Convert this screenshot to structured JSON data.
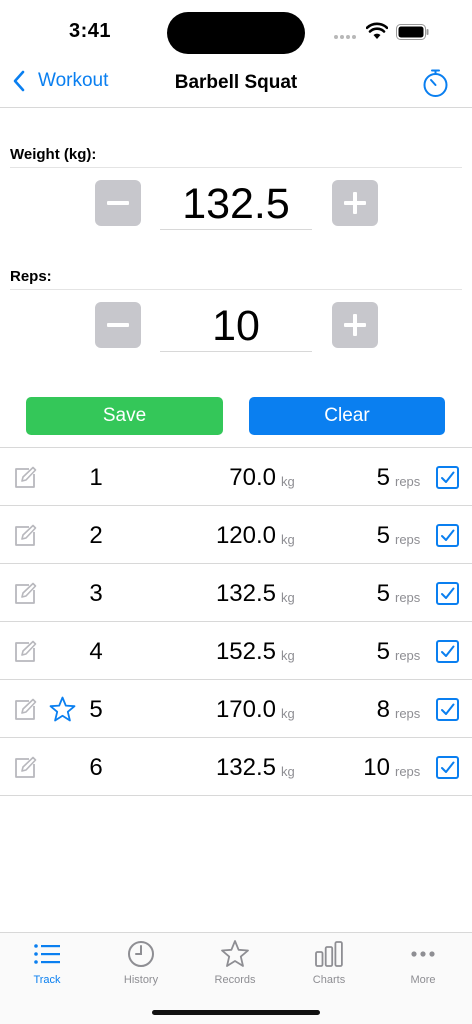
{
  "status": {
    "time": "3:41"
  },
  "nav": {
    "back_label": "Workout",
    "title": "Barbell Squat"
  },
  "weight": {
    "label": "Weight (kg):",
    "value": "132.5"
  },
  "reps": {
    "label": "Reps:",
    "value": "10"
  },
  "actions": {
    "save_label": "Save",
    "clear_label": "Clear"
  },
  "sets": [
    {
      "num": "1",
      "weight": "70.0",
      "unit": "kg",
      "reps": "5",
      "reps_unit": "reps",
      "starred": false,
      "checked": true
    },
    {
      "num": "2",
      "weight": "120.0",
      "unit": "kg",
      "reps": "5",
      "reps_unit": "reps",
      "starred": false,
      "checked": true
    },
    {
      "num": "3",
      "weight": "132.5",
      "unit": "kg",
      "reps": "5",
      "reps_unit": "reps",
      "starred": false,
      "checked": true
    },
    {
      "num": "4",
      "weight": "152.5",
      "unit": "kg",
      "reps": "5",
      "reps_unit": "reps",
      "starred": false,
      "checked": true
    },
    {
      "num": "5",
      "weight": "170.0",
      "unit": "kg",
      "reps": "8",
      "reps_unit": "reps",
      "starred": true,
      "checked": true
    },
    {
      "num": "6",
      "weight": "132.5",
      "unit": "kg",
      "reps": "10",
      "reps_unit": "reps",
      "starred": false,
      "checked": true
    }
  ],
  "tabs": [
    {
      "label": "Track",
      "icon": "list-icon",
      "active": true
    },
    {
      "label": "History",
      "icon": "clock-icon",
      "active": false
    },
    {
      "label": "Records",
      "icon": "star-icon",
      "active": false
    },
    {
      "label": "Charts",
      "icon": "bar-chart-icon",
      "active": false
    },
    {
      "label": "More",
      "icon": "ellipsis-icon",
      "active": false
    }
  ],
  "colors": {
    "accent": "#0a7ff0",
    "save": "#34c759",
    "stepper": "#c7c7cc",
    "inactive": "#8e8e93"
  }
}
